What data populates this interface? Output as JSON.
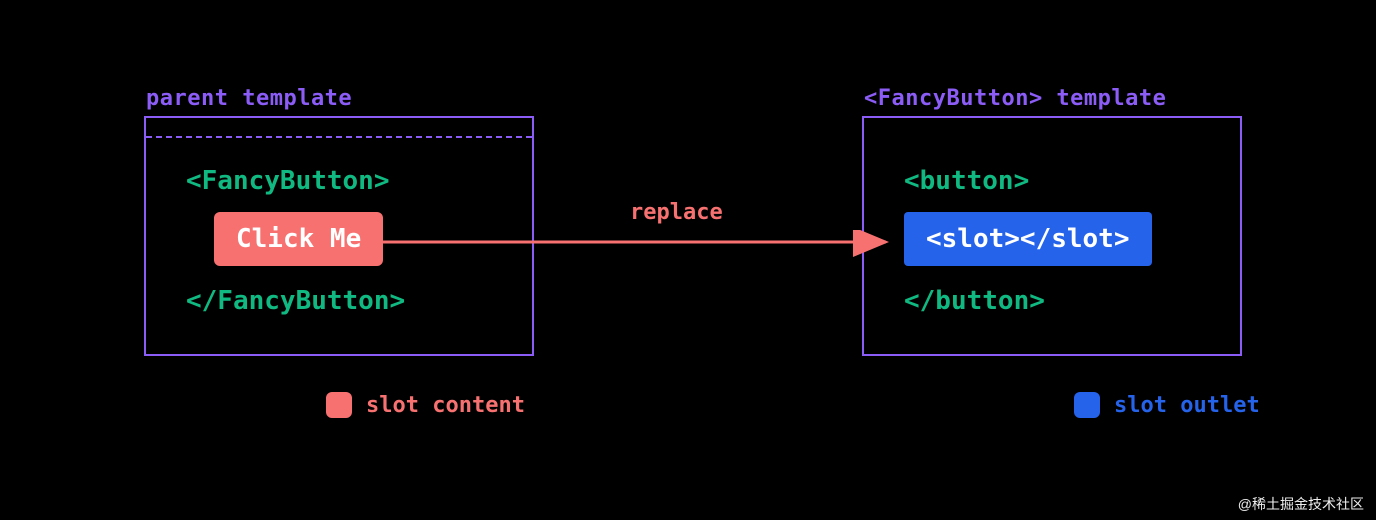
{
  "left": {
    "title": "parent template",
    "openTag": "<FancyButton>",
    "content": "Click Me",
    "closeTag": "</FancyButton>"
  },
  "right": {
    "title": "<FancyButton> template",
    "openTag": "<button>",
    "content": "<slot></slot>",
    "closeTag": "</button>"
  },
  "arrowLabel": "replace",
  "legend": {
    "slotContent": "slot content",
    "slotOutlet": "slot outlet"
  },
  "colors": {
    "purple": "#8b5cf6",
    "green": "#10b981",
    "red": "#f87171",
    "blue": "#2563eb"
  },
  "watermark": "@稀土掘金技术社区"
}
